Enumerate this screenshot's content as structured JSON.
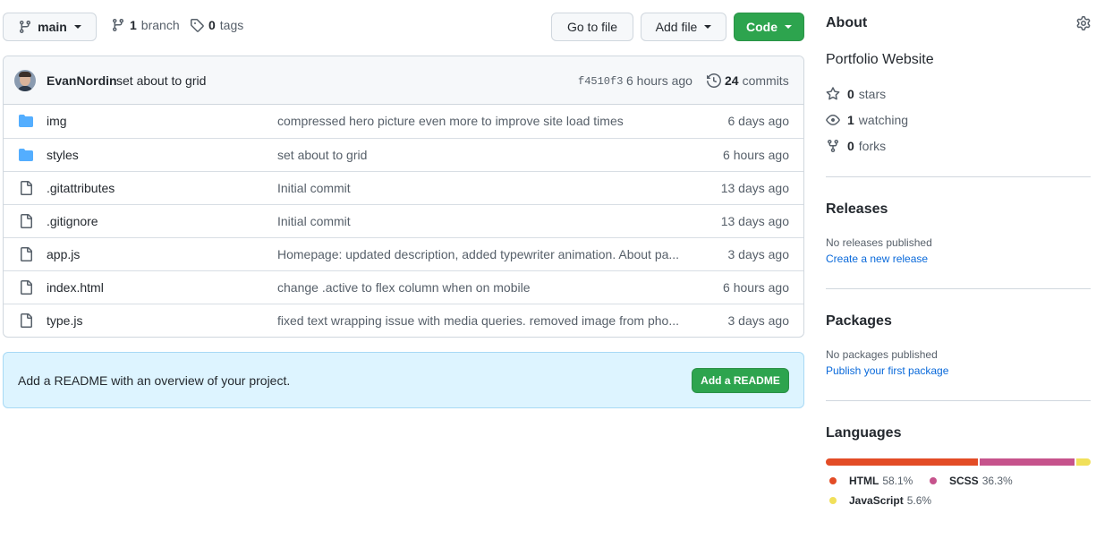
{
  "toolbar": {
    "branch_name": "main",
    "branch_count": "1",
    "branch_label": "branch",
    "tag_count": "0",
    "tag_label": "tags",
    "go_to_file": "Go to file",
    "add_file": "Add file",
    "code": "Code"
  },
  "commit": {
    "author": "EvanNordin",
    "message": "set about to grid",
    "sha": "f4510f3",
    "time": "6 hours ago",
    "count": "24",
    "count_label": "commits"
  },
  "files": [
    {
      "type": "folder",
      "name": "img",
      "message": "compressed hero picture even more to improve site load times",
      "age": "6 days ago"
    },
    {
      "type": "folder",
      "name": "styles",
      "message": "set about to grid",
      "age": "6 hours ago"
    },
    {
      "type": "file",
      "name": ".gitattributes",
      "message": "Initial commit",
      "age": "13 days ago"
    },
    {
      "type": "file",
      "name": ".gitignore",
      "message": "Initial commit",
      "age": "13 days ago"
    },
    {
      "type": "file",
      "name": "app.js",
      "message": "Homepage: updated description, added typewriter animation. About pa...",
      "age": "3 days ago"
    },
    {
      "type": "file",
      "name": "index.html",
      "message": "change .active to flex column when on mobile",
      "age": "6 hours ago"
    },
    {
      "type": "file",
      "name": "type.js",
      "message": "fixed text wrapping issue with media queries. removed image from pho...",
      "age": "3 days ago"
    }
  ],
  "readme": {
    "text": "Add a README with an overview of your project.",
    "button": "Add a README"
  },
  "about": {
    "title": "About",
    "description": "Portfolio Website",
    "stars_count": "0",
    "stars_label": "stars",
    "watching_count": "1",
    "watching_label": "watching",
    "forks_count": "0",
    "forks_label": "forks"
  },
  "releases": {
    "title": "Releases",
    "empty": "No releases published",
    "link": "Create a new release"
  },
  "packages": {
    "title": "Packages",
    "empty": "No packages published",
    "link": "Publish your first package"
  },
  "languages": {
    "title": "Languages",
    "items": [
      {
        "name": "HTML",
        "percent": "58.1%",
        "value": 58.1,
        "color": "#e34c26"
      },
      {
        "name": "SCSS",
        "percent": "36.3%",
        "value": 36.3,
        "color": "#c6538c"
      },
      {
        "name": "JavaScript",
        "percent": "5.6%",
        "value": 5.6,
        "color": "#f1e05a"
      }
    ]
  },
  "colors": {
    "accent_green": "#2da44e",
    "folder_blue": "#54aeff",
    "link_blue": "#0969da"
  }
}
